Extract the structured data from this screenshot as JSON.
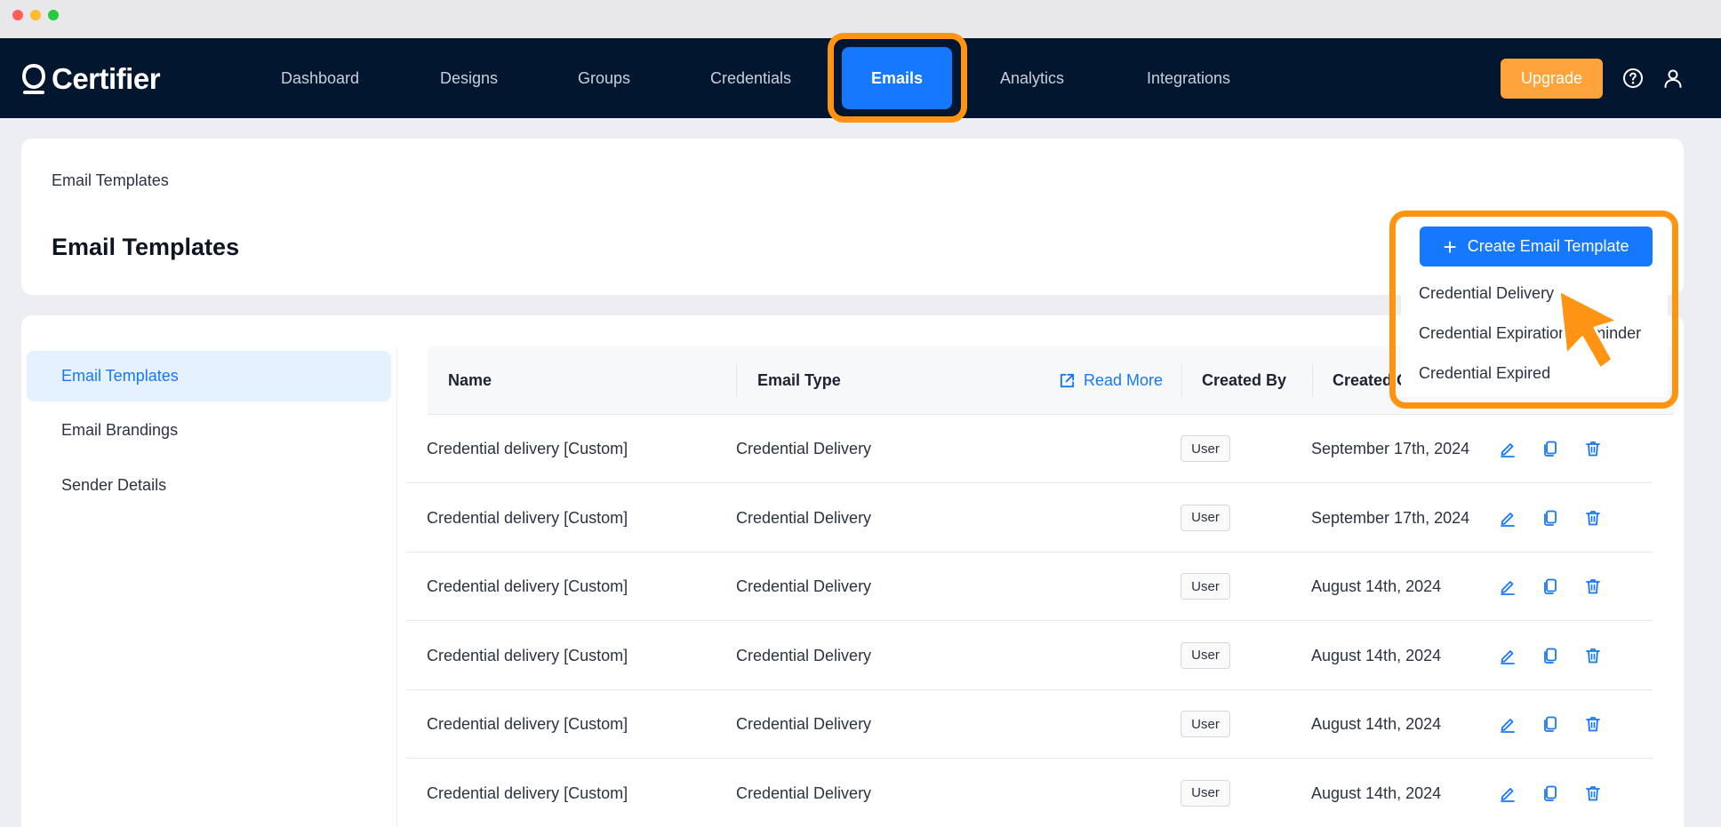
{
  "window": {
    "controls": [
      "close",
      "minimize",
      "maximize"
    ]
  },
  "navbar": {
    "logo_text": "Certifier",
    "items": [
      {
        "label": "Dashboard"
      },
      {
        "label": "Designs"
      },
      {
        "label": "Groups"
      },
      {
        "label": "Credentials"
      },
      {
        "label": "Emails",
        "active": true
      },
      {
        "label": "Analytics"
      },
      {
        "label": "Integrations"
      }
    ],
    "upgrade_label": "Upgrade",
    "icons": [
      "help-icon",
      "user-icon"
    ]
  },
  "header": {
    "breadcrumb": "Email Templates",
    "title": "Email Templates",
    "create_button_label": "Create Email Template",
    "create_menu": [
      "Credential Delivery",
      "Credential Expiration Reminder",
      "Credential Expired"
    ]
  },
  "sidebar": {
    "items": [
      {
        "label": "Email Templates",
        "active": true
      },
      {
        "label": "Email Brandings"
      },
      {
        "label": "Sender Details"
      }
    ]
  },
  "table": {
    "columns": {
      "name": "Name",
      "email_type": "Email Type",
      "read_more": "Read More",
      "created_by": "Created By",
      "created_on": "Created On"
    },
    "rows": [
      {
        "name": "Credential delivery [Custom]",
        "type": "Credential Delivery",
        "created_by": "User",
        "created_on": "September 17th, 2024"
      },
      {
        "name": "Credential delivery [Custom]",
        "type": "Credential Delivery",
        "created_by": "User",
        "created_on": "September 17th, 2024"
      },
      {
        "name": "Credential delivery [Custom]",
        "type": "Credential Delivery",
        "created_by": "User",
        "created_on": "August 14th, 2024"
      },
      {
        "name": "Credential delivery [Custom]",
        "type": "Credential Delivery",
        "created_by": "User",
        "created_on": "August 14th, 2024"
      },
      {
        "name": "Credential delivery [Custom]",
        "type": "Credential Delivery",
        "created_by": "User",
        "created_on": "August 14th, 2024"
      },
      {
        "name": "Credential delivery [Custom]",
        "type": "Credential Delivery",
        "created_by": "User",
        "created_on": "August 14th, 2024"
      }
    ],
    "row_actions": [
      "edit-icon",
      "duplicate-icon",
      "delete-icon"
    ]
  },
  "colors": {
    "navbar_bg": "#03162f",
    "accent": "#1677ff",
    "upgrade": "#ffa43a",
    "highlight": "#ff9412"
  }
}
